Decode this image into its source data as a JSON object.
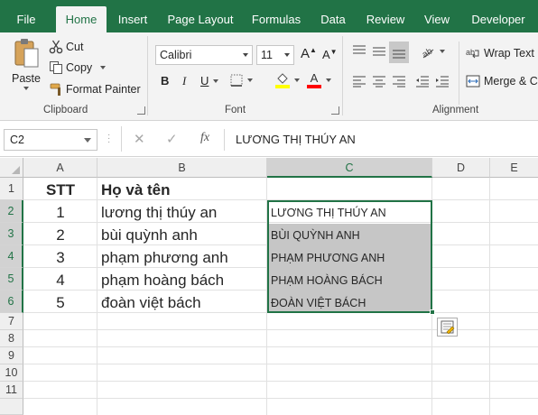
{
  "ribbon_tabs": [
    "File",
    "Home",
    "Insert",
    "Page Layout",
    "Formulas",
    "Data",
    "Review",
    "View",
    "Developer"
  ],
  "active_tab": "Home",
  "clipboard": {
    "paste": "Paste",
    "cut": "Cut",
    "copy": "Copy",
    "format_painter": "Format Painter",
    "label": "Clipboard"
  },
  "font": {
    "name": "Calibri",
    "size": "11",
    "grow": "A",
    "shrink": "A",
    "bold": "B",
    "italic": "I",
    "underline": "U",
    "color_letter": "A",
    "label": "Font",
    "highlight_color": "#ffff00",
    "font_color": "#ff0000"
  },
  "alignment": {
    "wrap_text": "Wrap Text",
    "merge": "Merge & C",
    "label": "Alignment"
  },
  "formula_bar": {
    "name_box": "C2",
    "fx": "fx",
    "cancel": "✕",
    "enter": "✓",
    "content": "LƯƠNG THỊ THÚY AN"
  },
  "columns": [
    "A",
    "B",
    "C",
    "D",
    "E"
  ],
  "rows": [
    "1",
    "2",
    "3",
    "4",
    "5",
    "6",
    "7",
    "8",
    "9",
    "10",
    "11"
  ],
  "sheet": {
    "header": {
      "stt": "STT",
      "name": "Họ và tên"
    },
    "records": [
      {
        "stt": "1",
        "name": "lương thị thúy an",
        "upper": "LƯƠNG THỊ THÚY AN"
      },
      {
        "stt": "2",
        "name": "bùi quỳnh anh",
        "upper": "BÙI QUỲNH ANH"
      },
      {
        "stt": "3",
        "name": "phạm phương anh",
        "upper": "PHẠM PHƯƠNG ANH"
      },
      {
        "stt": "4",
        "name": "phạm hoàng bách",
        "upper": "PHẠM HOÀNG BÁCH"
      },
      {
        "stt": "5",
        "name": "đoàn việt bách",
        "upper": "ĐOÀN VIỆT BÁCH"
      }
    ]
  },
  "selected_column": "C",
  "selected_rows": [
    "2",
    "3",
    "4",
    "5",
    "6"
  ],
  "accent_color": "#217346"
}
